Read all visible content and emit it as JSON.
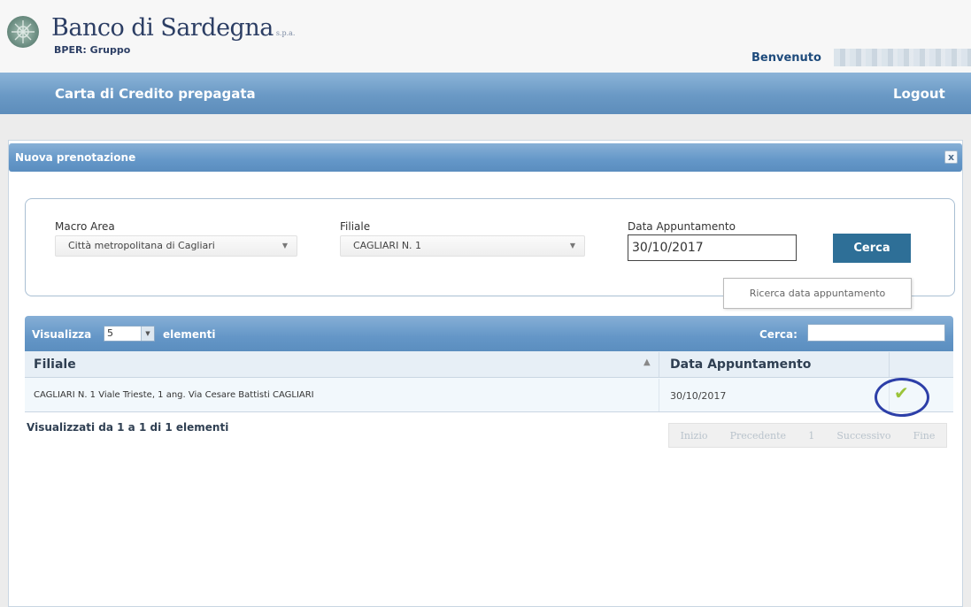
{
  "header": {
    "brand_name": "Banco di Sardegna",
    "brand_suffix": "s.p.a.",
    "brand_group": "BPER: Gruppo",
    "welcome": "Benvenuto",
    "user_name": "•••••••••••"
  },
  "navbar": {
    "app_title": "Carta di Credito prepagata",
    "logout": "Logout"
  },
  "dialog": {
    "title": "Nuova prenotazione",
    "close": "x"
  },
  "search_form": {
    "macro_area_label": "Macro Area",
    "macro_area_value": "Città metropolitana di Cagliari",
    "filiale_label": "Filiale",
    "filiale_value": "CAGLIARI N. 1",
    "data_label": "Data Appuntamento",
    "data_value": "30/10/2017",
    "search_button": "Cerca",
    "tooltip": "Ricerca data appuntamento"
  },
  "table": {
    "show_label": "Visualizza",
    "page_size": "5",
    "elements_label": "elementi",
    "search_label": "Cerca:",
    "search_value": "",
    "columns": [
      "Filiale",
      "Data Appuntamento"
    ],
    "rows": [
      {
        "filiale": "CAGLIARI N. 1 Viale Trieste, 1 ang. Via Cesare Battisti CAGLIARI",
        "data": "30/10/2017",
        "icon": "check-icon"
      }
    ],
    "info": "Visualizzati da 1 a 1 di 1 elementi",
    "pagination": {
      "first": "Inizio",
      "prev": "Precedente",
      "page": "1",
      "next": "Successivo",
      "last": "Fine"
    }
  },
  "colors": {
    "header_bar": "#6a99c5",
    "button": "#2e6f97",
    "check": "#9bc43a",
    "highlight": "#2d3fa8"
  }
}
